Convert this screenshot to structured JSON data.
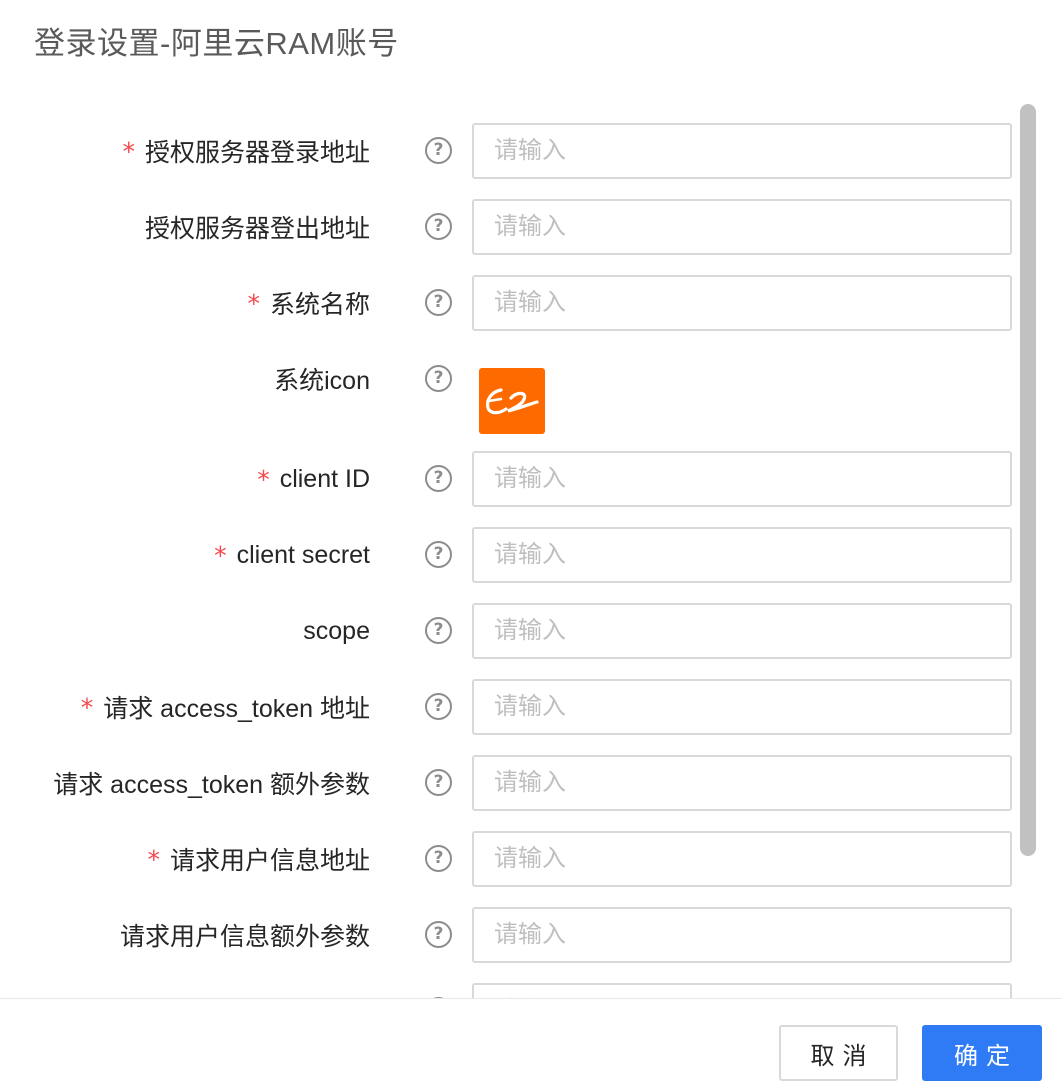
{
  "dialog": {
    "title": "登录设置-阿里云RAM账号"
  },
  "form": {
    "placeholder": "请输入",
    "help_glyph": "?",
    "required_mark": "*",
    "fields": [
      {
        "label": "授权服务器登录地址",
        "required": true,
        "value": ""
      },
      {
        "label": "授权服务器登出地址",
        "required": false,
        "value": ""
      },
      {
        "label": "系统名称",
        "required": true,
        "value": ""
      },
      {
        "label": "系统icon",
        "required": false,
        "type": "image"
      },
      {
        "label": "client ID",
        "required": true,
        "value": ""
      },
      {
        "label": "client secret",
        "required": true,
        "value": ""
      },
      {
        "label": "scope",
        "required": false,
        "value": ""
      },
      {
        "label": "请求 access_token 地址",
        "required": true,
        "value": ""
      },
      {
        "label": "请求 access_token 额外参数",
        "required": false,
        "value": ""
      },
      {
        "label": "请求用户信息地址",
        "required": true,
        "value": ""
      },
      {
        "label": "请求用户信息额外参数",
        "required": false,
        "value": ""
      }
    ]
  },
  "icon_preview": {
    "icon": "alibaba-logo-icon",
    "background": "#ff6a00"
  },
  "footer": {
    "cancel_label": "取消",
    "ok_label": "确定"
  },
  "colors": {
    "primary": "#2f7bf5",
    "required": "#f5484d",
    "border": "#d9d9d9",
    "placeholder": "#bfbfbf"
  }
}
